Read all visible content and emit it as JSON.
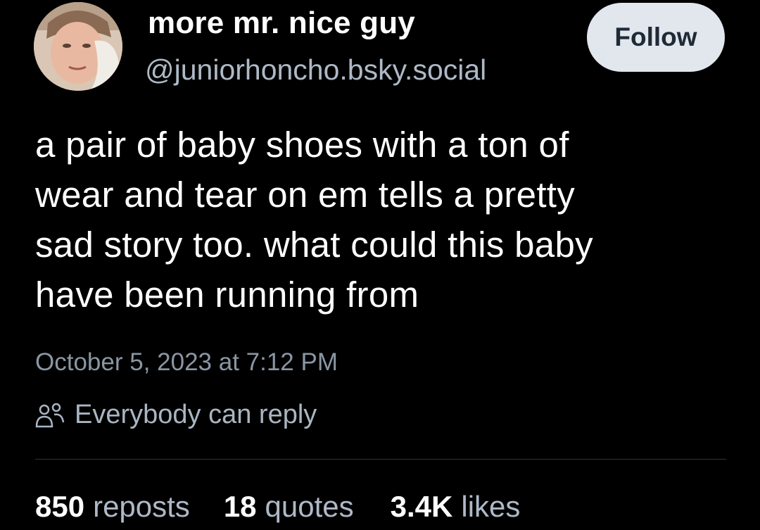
{
  "author": {
    "display_name": "more mr. nice guy",
    "handle": "@juniorhoncho.bsky.social",
    "avatar_icon": "user-avatar"
  },
  "follow_button": {
    "label": "Follow"
  },
  "post": {
    "text": "a pair of baby shoes with a ton of\nwear and tear on em tells a pretty\nsad story too. what could this baby\nhave been running from",
    "timestamp": "October 5, 2023 at 7:12 PM"
  },
  "reply_setting": {
    "icon": "people-icon",
    "label": "Everybody can reply"
  },
  "stats": {
    "reposts": {
      "value": "850",
      "label": "reposts"
    },
    "quotes": {
      "value": "18",
      "label": "quotes"
    },
    "likes": {
      "value": "3.4K",
      "label": "likes"
    }
  },
  "colors": {
    "background": "#000000",
    "text_primary": "#ffffff",
    "text_secondary": "#aeb9c6",
    "button_bg": "#e2e7ee",
    "button_text": "#1f2a37",
    "divider": "#2a3440"
  }
}
